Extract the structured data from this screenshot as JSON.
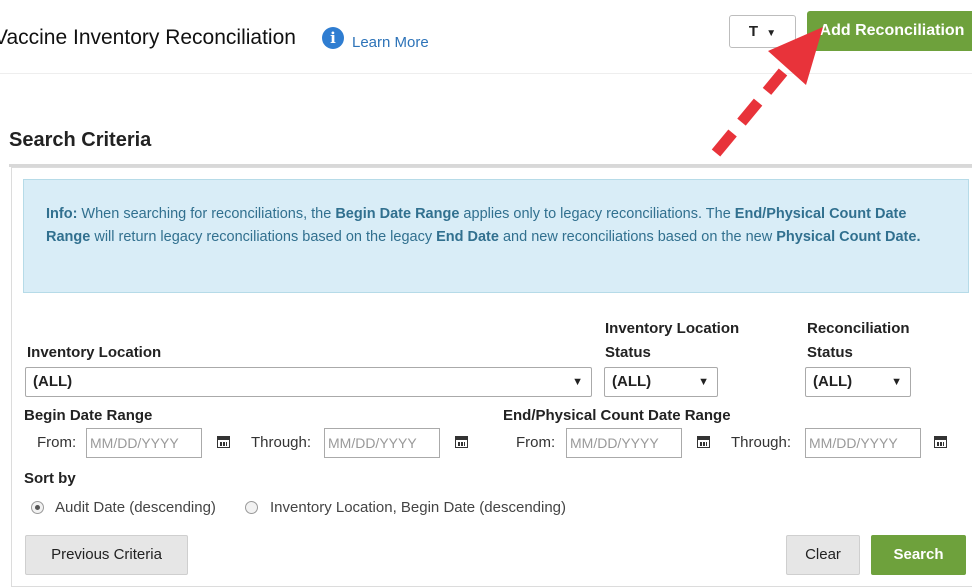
{
  "header": {
    "title": "Vaccine Inventory Reconciliation",
    "learn_more": "Learn More",
    "info_icon": "info-circle-icon",
    "tool_icon": "T",
    "add_button": "Add Reconciliation"
  },
  "search": {
    "title": "Search Criteria",
    "info": {
      "prefix": "Info:",
      "t1": " When searching for reconciliations, the ",
      "b1": "Begin Date Range",
      "t2": " applies only to legacy reconciliations. The ",
      "b2": "End/Physical Count Date Range",
      "t3": " will return legacy reconciliations based on the legacy ",
      "b3": "End Date",
      "t4": " and new reconciliations based on the new ",
      "b4": "Physical Count Date."
    },
    "inventory_location": {
      "label": "Inventory Location",
      "value": "(ALL)"
    },
    "inventory_location_status": {
      "label_line1": "Inventory Location",
      "label_line2": "Status",
      "value": "(ALL)"
    },
    "reconciliation_status": {
      "label_line1": "Reconciliation",
      "label_line2": "Status",
      "value": "(ALL)"
    },
    "begin_date_range": {
      "label": "Begin Date Range",
      "from": "From:",
      "through": "Through:",
      "placeholder": "MM/DD/YYYY"
    },
    "end_date_range": {
      "label": "End/Physical Count Date Range",
      "from": "From:",
      "through": "Through:",
      "placeholder": "MM/DD/YYYY"
    },
    "sort_by": {
      "label": "Sort by",
      "options": [
        "Audit Date (descending)",
        "Inventory Location, Begin Date (descending)"
      ],
      "selected": 0
    },
    "buttons": {
      "previous": "Previous Criteria",
      "clear": "Clear",
      "search": "Search"
    }
  },
  "colors": {
    "accent_green": "#6ea13c",
    "info_bg": "#d9edf7",
    "info_text": "#31708f",
    "link": "#2d73b8",
    "arrow_red": "#e8333a"
  }
}
